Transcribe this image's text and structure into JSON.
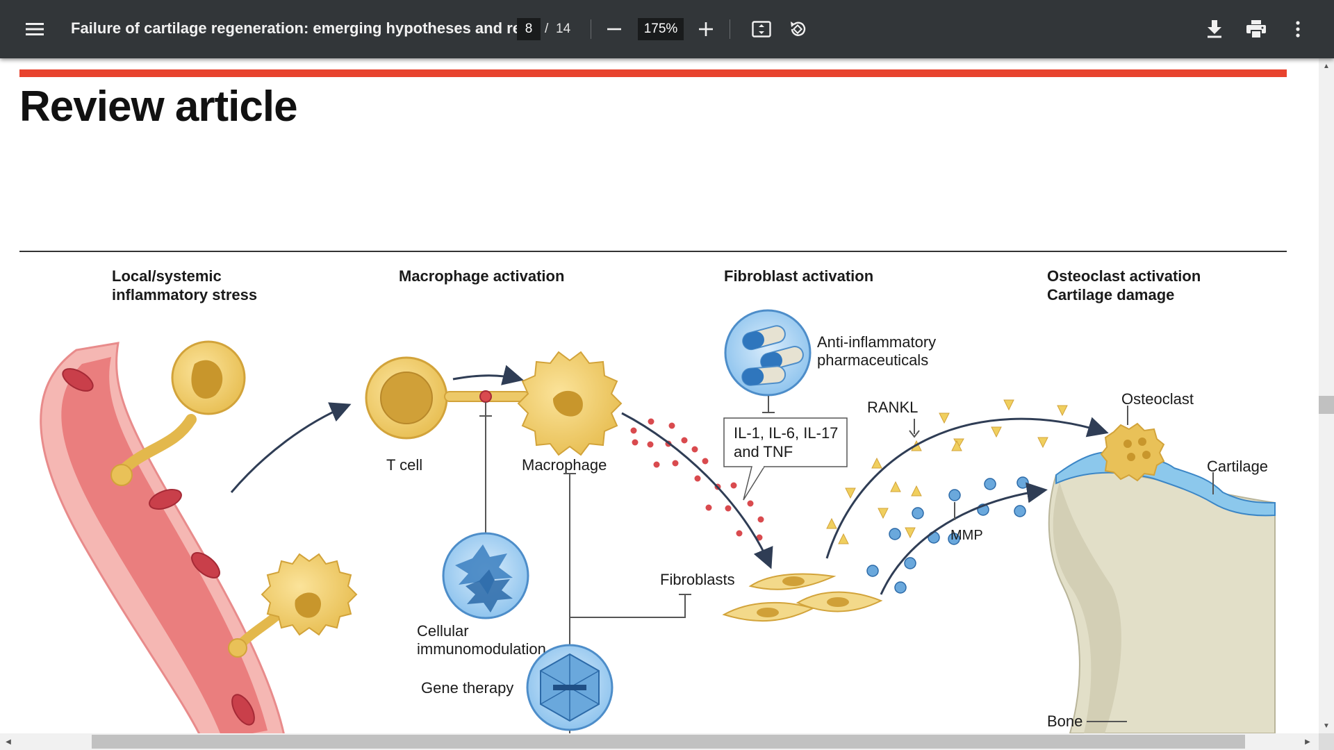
{
  "toolbar": {
    "menu_icon": "hamburger-menu-icon",
    "title": "Failure of cartilage regeneration: emerging hypotheses and rel...",
    "page_current": "8",
    "page_separator": "/",
    "page_total": "14",
    "zoom": "175%",
    "zoom_out_icon": "minus-icon",
    "zoom_in_icon": "plus-icon",
    "fit_icon": "fit-to-page-icon",
    "rotate_icon": "rotate-icon",
    "download_icon": "download-icon",
    "print_icon": "print-icon",
    "more_icon": "more-vert-icon"
  },
  "document": {
    "section_heading": "Review article",
    "accent_color": "#e8432e"
  },
  "figure": {
    "panels": {
      "inflammatory_line1": "Local/systemic",
      "inflammatory_line2": "inflammatory stress",
      "macrophage": "Macrophage activation",
      "fibroblast": "Fibroblast activation",
      "osteoclast_line1": "Osteoclast activation",
      "osteoclast_line2": "Cartilage damage"
    },
    "labels": {
      "tcell": "T cell",
      "macrophage": "Macrophage",
      "cellular_line1": "Cellular",
      "cellular_line2": "immunomodulation",
      "gene_therapy": "Gene therapy",
      "anti_inflam_line1": "Anti-inflammatory",
      "anti_inflam_line2": "pharmaceuticals",
      "cytokines_line1": "IL-1, IL-6, IL-17",
      "cytokines_line2": "and TNF",
      "fibroblasts": "Fibroblasts",
      "rankl": "RANKL",
      "mmp": "MMP",
      "osteoclast": "Osteoclast",
      "cartilage": "Cartilage",
      "bone": "Bone"
    }
  }
}
